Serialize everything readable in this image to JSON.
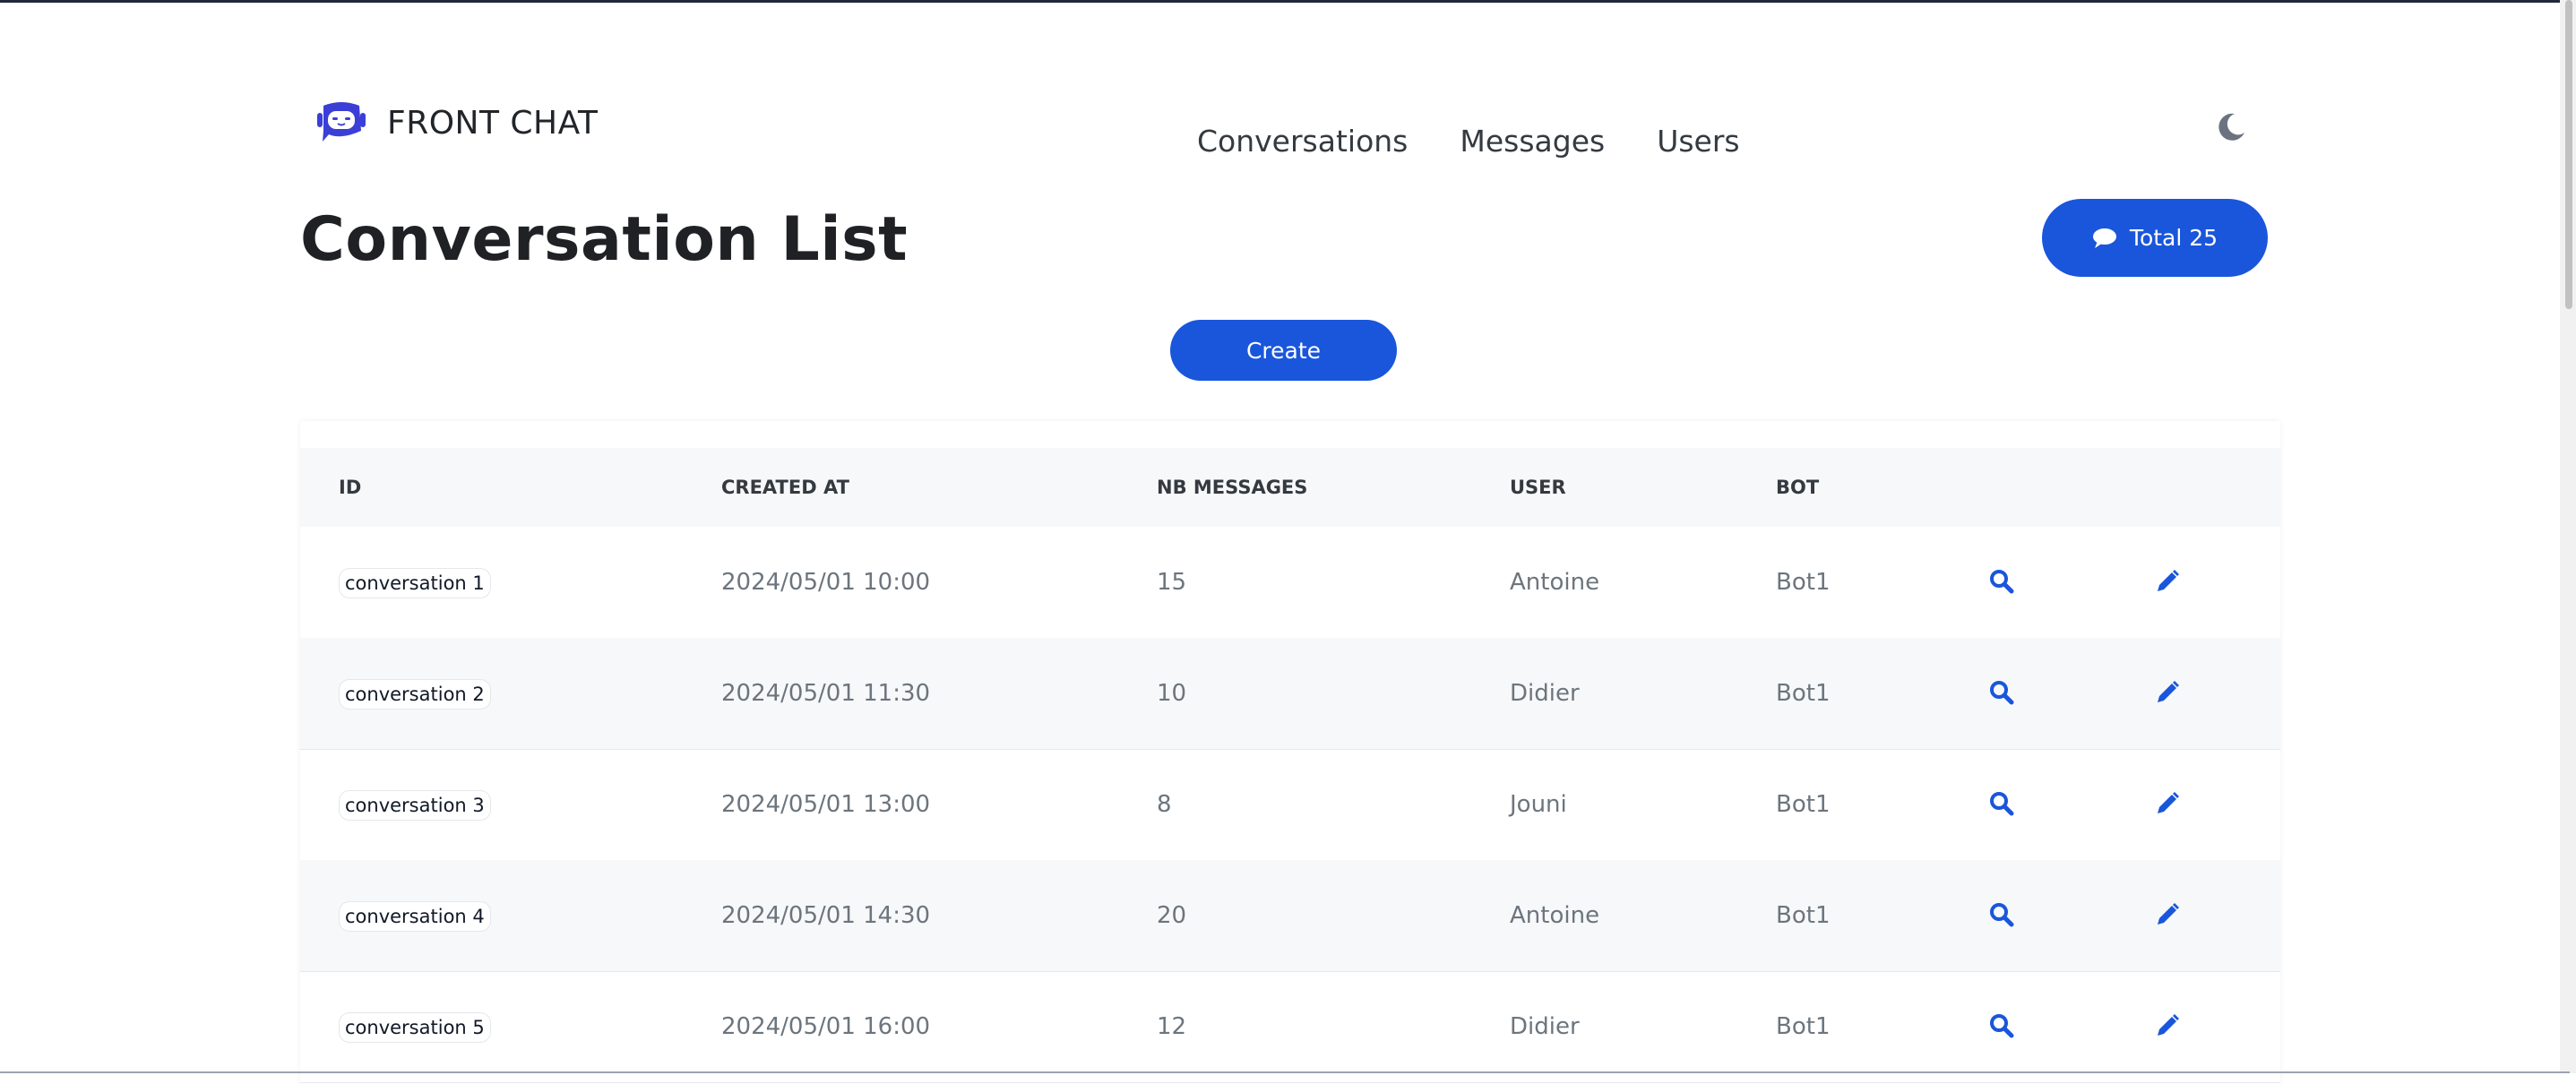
{
  "brand": {
    "name": "FRONT CHAT",
    "logo_icon": "robot-chat-icon"
  },
  "nav": {
    "items": [
      "Conversations",
      "Messages",
      "Users"
    ]
  },
  "theme_toggle_icon": "moon-icon",
  "page": {
    "title": "Conversation List",
    "total_button": "Total 25",
    "total_icon": "comment-icon",
    "create_button": "Create"
  },
  "accent_color": "#1a56db",
  "table": {
    "headers": [
      "ID",
      "CREATED AT",
      "NB MESSAGES",
      "USER",
      "BOT"
    ],
    "rows": [
      {
        "id": "conversation 1",
        "created_at": "2024/05/01 10:00",
        "nb_messages": "15",
        "user": "Antoine",
        "bot": "Bot1"
      },
      {
        "id": "conversation 2",
        "created_at": "2024/05/01 11:30",
        "nb_messages": "10",
        "user": "Didier",
        "bot": "Bot1"
      },
      {
        "id": "conversation 3",
        "created_at": "2024/05/01 13:00",
        "nb_messages": "8",
        "user": "Jouni",
        "bot": "Bot1"
      },
      {
        "id": "conversation 4",
        "created_at": "2024/05/01 14:30",
        "nb_messages": "20",
        "user": "Antoine",
        "bot": "Bot1"
      },
      {
        "id": "conversation 5",
        "created_at": "2024/05/01 16:00",
        "nb_messages": "12",
        "user": "Didier",
        "bot": "Bot1"
      }
    ],
    "row_actions": [
      "search-icon",
      "pencil-icon"
    ]
  }
}
